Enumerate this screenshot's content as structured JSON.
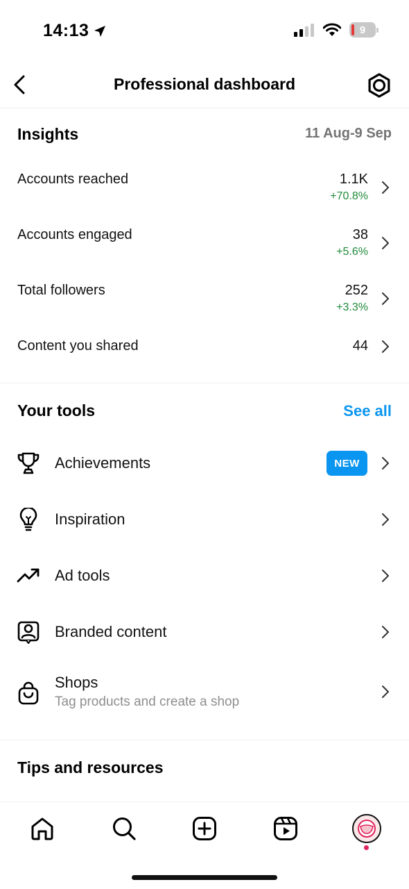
{
  "status_bar": {
    "time": "14:13",
    "battery_level": "9",
    "icons": [
      "location-arrow-icon",
      "cellular-signal-icon",
      "wifi-icon",
      "battery-icon"
    ]
  },
  "header": {
    "title": "Professional dashboard",
    "back_icon": "chevron-left-icon",
    "settings_icon": "settings-icon"
  },
  "insights": {
    "title": "Insights",
    "date_range": "11 Aug-9 Sep",
    "metrics": [
      {
        "label": "Accounts reached",
        "value": "1.1K",
        "change": "+70.8%"
      },
      {
        "label": "Accounts engaged",
        "value": "38",
        "change": "+5.6%"
      },
      {
        "label": "Total followers",
        "value": "252",
        "change": "+3.3%"
      },
      {
        "label": "Content you shared",
        "value": "44",
        "change": ""
      }
    ]
  },
  "tools": {
    "title": "Your tools",
    "see_all": "See all",
    "items": [
      {
        "label": "Achievements",
        "icon": "trophy-icon",
        "badge": "NEW"
      },
      {
        "label": "Inspiration",
        "icon": "lightbulb-icon"
      },
      {
        "label": "Ad tools",
        "icon": "trending-up-icon"
      },
      {
        "label": "Branded content",
        "icon": "branded-content-icon"
      },
      {
        "label": "Shops",
        "icon": "shopping-bag-icon",
        "subtitle": "Tag products and create a shop"
      }
    ]
  },
  "tips": {
    "title": "Tips and resources"
  },
  "bottom_nav": {
    "items": [
      "home-icon",
      "search-icon",
      "create-icon",
      "reels-icon",
      "profile-avatar"
    ]
  },
  "colors": {
    "accent": "#0a95f0",
    "positive": "#1f8a3a",
    "muted": "#737373",
    "divider": "#efefef",
    "notification": "#e0245e"
  }
}
